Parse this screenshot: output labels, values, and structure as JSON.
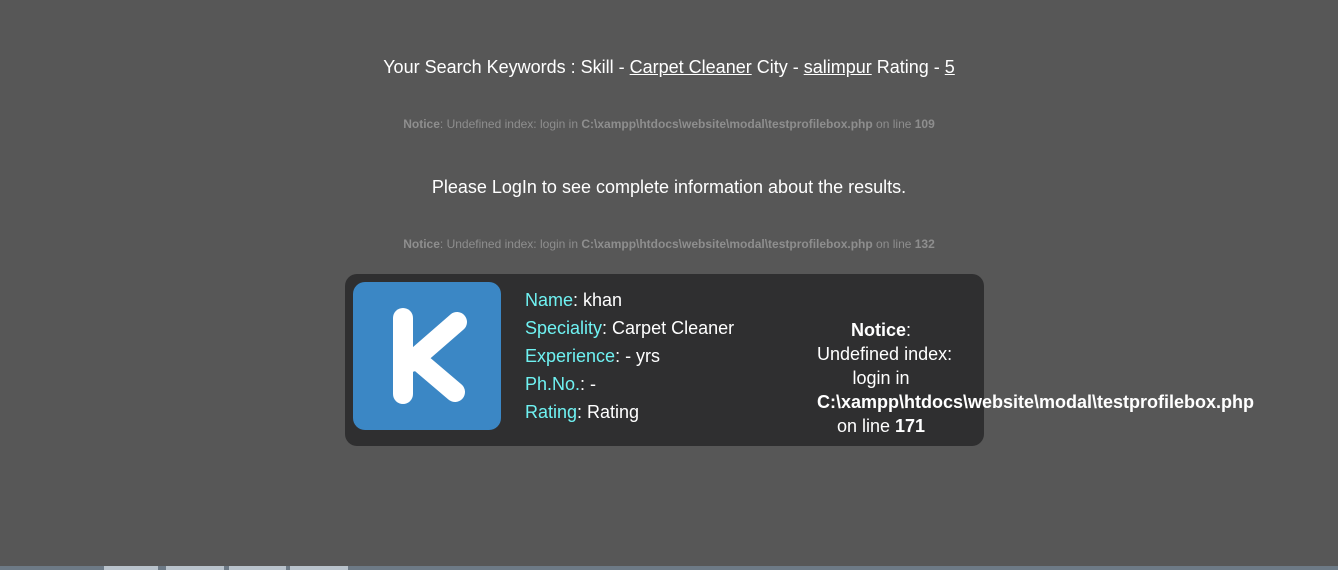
{
  "search": {
    "prefix": "Your Search Keywords : Skill - ",
    "skill": "Carpet Cleaner",
    "city_label": " City - ",
    "city": "salimpur",
    "rating_label": " Rating - ",
    "rating": "5"
  },
  "notice1": {
    "label": "Notice",
    "text": ": Undefined index: login in ",
    "path": "C:\\xampp\\htdocs\\website\\modal\\testprofilebox.php",
    "online": " on line ",
    "line": "109"
  },
  "login_message": "Please LogIn to see complete information about the results.",
  "notice2": {
    "label": "Notice",
    "text": ": Undefined index: login in ",
    "path": "C:\\xampp\\htdocs\\website\\modal\\testprofilebox.php",
    "online": " on line ",
    "line": "132"
  },
  "profile": {
    "avatar_letter": "K",
    "name_label": "Name",
    "name": ": khan",
    "speciality_label": "Speciality",
    "speciality": ": Carpet Cleaner",
    "experience_label": "Experience",
    "experience": ": - yrs",
    "phone_label": "Ph.No.",
    "phone": ": -",
    "rating_label": "Rating",
    "rating": ": Rating"
  },
  "card_notice": {
    "label": "Notice",
    "colon": ":",
    "line1": "Undefined index:",
    "line2": "login in",
    "path": "C:\\xampp\\htdocs\\website\\modal\\testprofilebox.php",
    "online": "on line ",
    "line": "171"
  },
  "colors": {
    "background": "#575757",
    "card": "#2f2f30",
    "avatar": "#3b87c5",
    "label_cyan": "#6ff2f2"
  }
}
